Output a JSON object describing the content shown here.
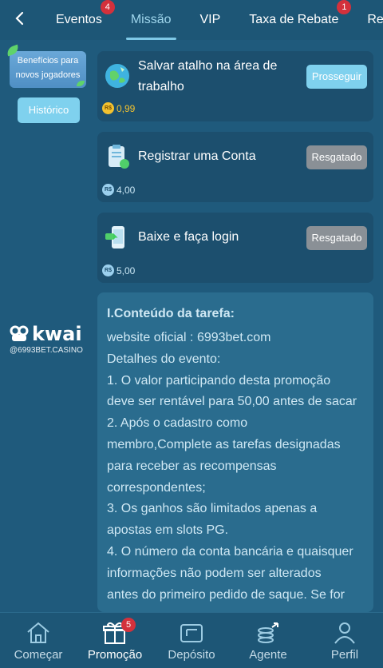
{
  "tabs": [
    {
      "label": "Eventos",
      "badge": "4"
    },
    {
      "label": "Missão",
      "badge": ""
    },
    {
      "label": "VIP",
      "badge": ""
    },
    {
      "label": "Taxa de Rebate",
      "badge": "1"
    },
    {
      "label": "Rec",
      "badge": ""
    }
  ],
  "sidebar": {
    "banner_line1": "Benefícios para",
    "banner_line2": "novos jogadores",
    "history_label": "Histórico"
  },
  "watermark": {
    "brand": "kwai",
    "user": "@6993BET.CASINO"
  },
  "tasks": [
    {
      "title_line1": "Salvar atalho na área de",
      "title_line2": "trabalho",
      "button": "Prosseguir",
      "reward": "0,99",
      "coin_label": "R$",
      "icon": "globe-icon"
    },
    {
      "title_line1": "Registrar uma Conta",
      "title_line2": "",
      "button": "Resgatado",
      "reward": "4,00",
      "coin_label": "R$",
      "icon": "clipboard-icon"
    },
    {
      "title_line1": "Baixe e faça login",
      "title_line2": "",
      "button": "Resgatado",
      "reward": "5,00",
      "coin_label": "R$",
      "icon": "phone-download-icon"
    }
  ],
  "content": {
    "heading": "I.Conteúdo da tarefa:",
    "lines": [
      "website oficial : 6993bet.com",
      "Detalhes do evento:",
      "1. O valor participando desta promoção",
      "deve ser rentável para 50,00 antes de sacar",
      "2. Após o cadastro como",
      "membro,Complete as tarefas designadas",
      "para receber as recompensas",
      "correspondentes;",
      "3. Os ganhos são limitados apenas a",
      "apostas em slots PG.",
      "4. O número da conta bancária e quaisquer",
      "informações não podem ser alterados",
      "antes do primeiro pedido de saque. Se for"
    ]
  },
  "bottom_nav": [
    {
      "label": "Começar",
      "badge": ""
    },
    {
      "label": "Promoção",
      "badge": "5"
    },
    {
      "label": "Depósito",
      "badge": ""
    },
    {
      "label": "Agente",
      "badge": ""
    },
    {
      "label": "Perfil",
      "badge": ""
    }
  ],
  "colors": {
    "background": "#1f5a7c",
    "accent": "#7fd1ee",
    "badge": "#d3313c",
    "coin_gold": "#f2c230"
  }
}
